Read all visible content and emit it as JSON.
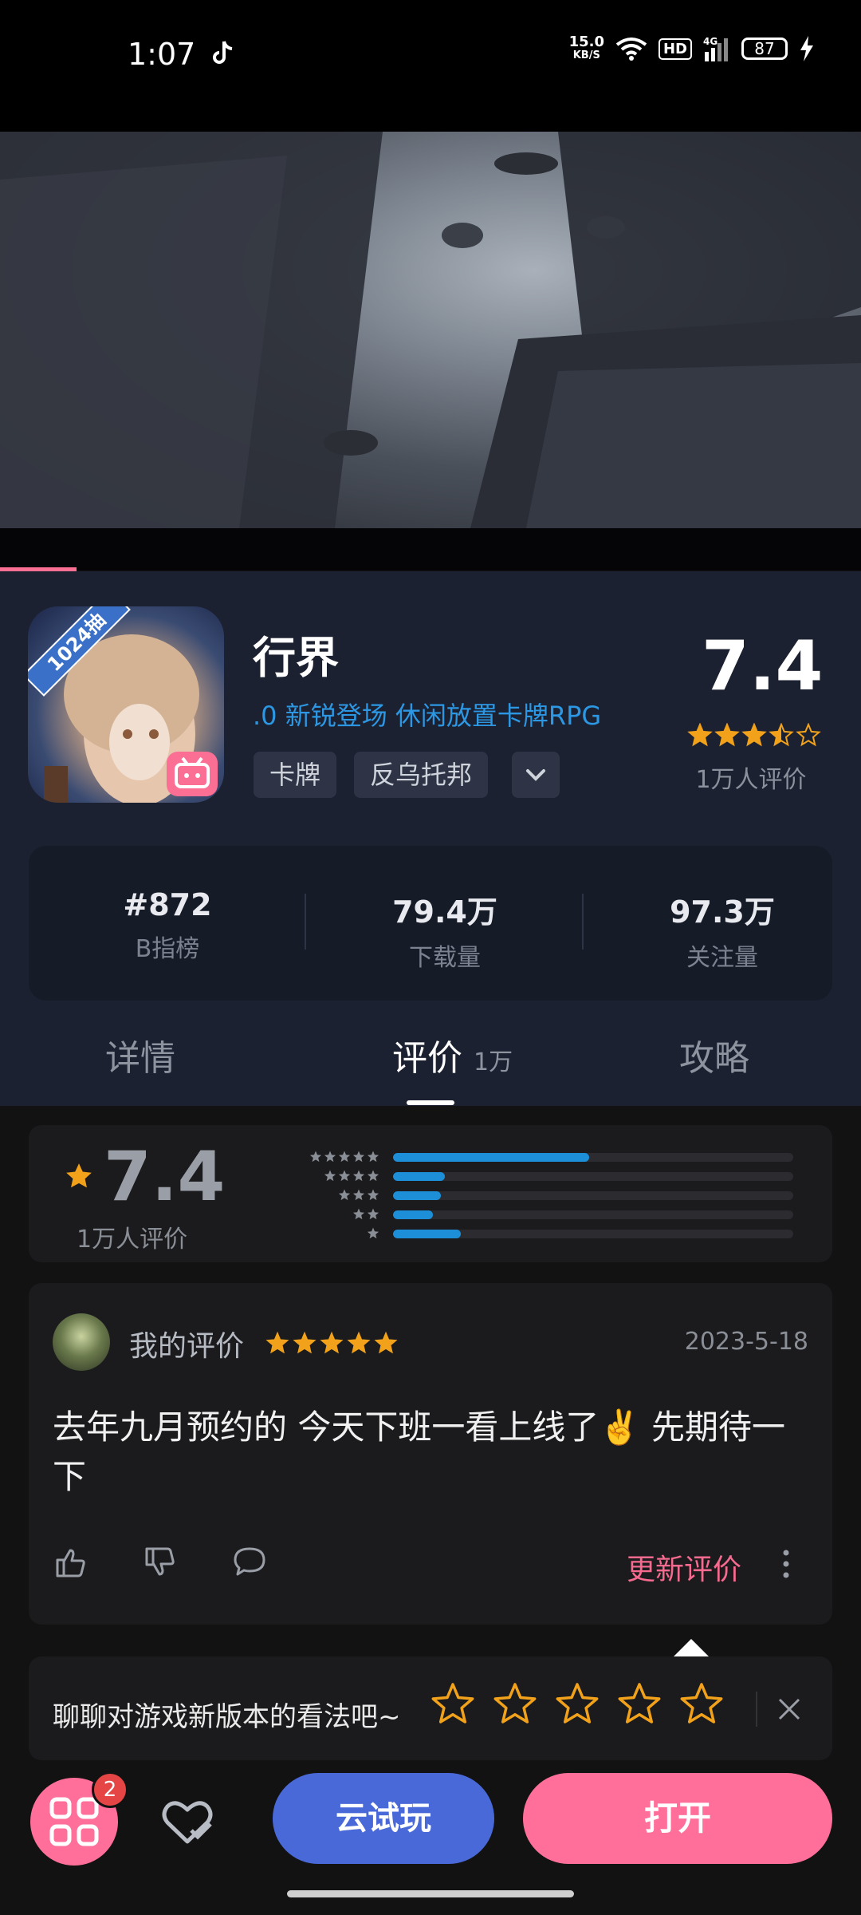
{
  "status_bar": {
    "time": "1:07",
    "speed_value": "15.0",
    "speed_unit": "KB/S",
    "hd": "HD",
    "network": "4G",
    "battery": "87"
  },
  "video": {
    "progress_fraction": 0.09
  },
  "app": {
    "icon_ribbon": "1024抽",
    "title": "行界",
    "subtitle": ".0 新锐登场 休闲放置卡牌RPG",
    "tags": [
      "卡牌",
      "反乌托邦"
    ],
    "score": "7.4",
    "score_stars": 3.5,
    "rating_count": "1万人评价"
  },
  "stats": [
    {
      "value": "#872",
      "label": "B指榜"
    },
    {
      "value": "79.4万",
      "label": "下载量"
    },
    {
      "value": "97.3万",
      "label": "关注量"
    }
  ],
  "tabs": {
    "details": "详情",
    "reviews": "评价",
    "reviews_count": "1万",
    "guides": "攻略"
  },
  "rating_summary": {
    "score": "7.4",
    "count": "1万人评价",
    "distribution": [
      {
        "stars": 5,
        "fraction": 0.49
      },
      {
        "stars": 4,
        "fraction": 0.13
      },
      {
        "stars": 3,
        "fraction": 0.12
      },
      {
        "stars": 2,
        "fraction": 0.1
      },
      {
        "stars": 1,
        "fraction": 0.17
      }
    ]
  },
  "my_review": {
    "label": "我的评价",
    "stars": 5,
    "date": "2023-5-18",
    "text": "去年九月预约的 今天下班一看上线了✌️ 先期待一下",
    "update_label": "更新评价"
  },
  "prompt_bar": {
    "text": "聊聊对游戏新版本的看法吧~"
  },
  "bottom_bar": {
    "badge": "2",
    "cloud_play": "云试玩",
    "open": "打开"
  },
  "colors": {
    "accent_pink": "#ff6f9a",
    "accent_blue": "#4a69d8",
    "star_orange": "#f1a21a",
    "link_blue": "#2c97e3"
  }
}
